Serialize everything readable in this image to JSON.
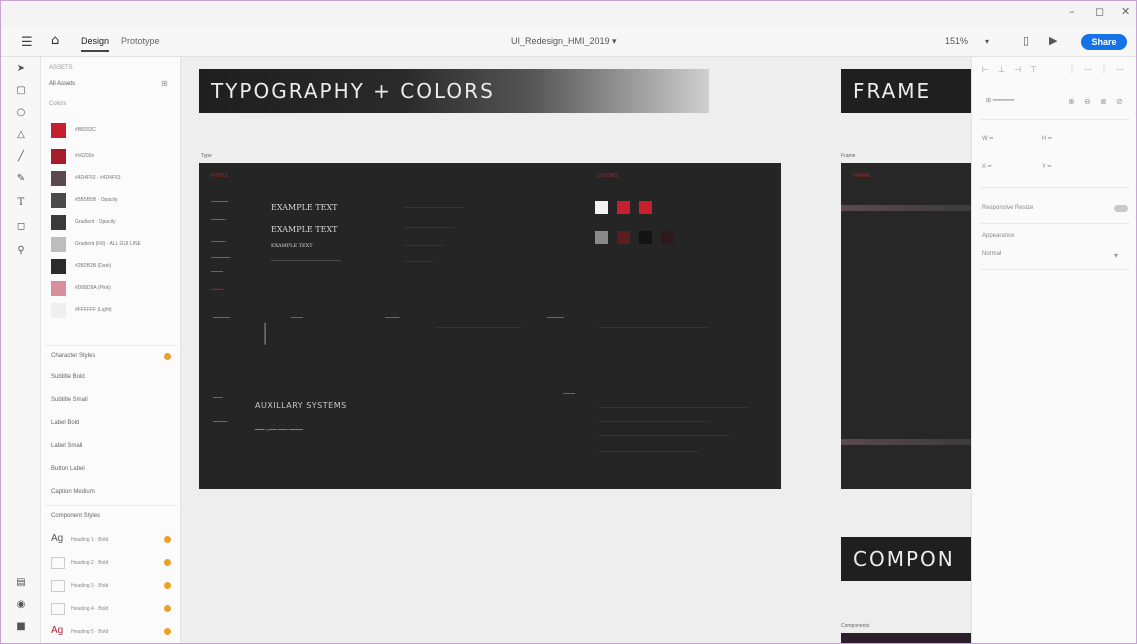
{
  "window": {
    "minimize": "–",
    "maximize": "◻",
    "close": "✕"
  },
  "header": {
    "menu_icon": "hamburger-icon",
    "home_icon": "home-icon",
    "tabs": [
      {
        "label": "Design"
      },
      {
        "label": "Prototype"
      }
    ],
    "document_title": "UI_Redesign_HMI_2019 ▾",
    "zoom": "151%",
    "share_label": "Share"
  },
  "assets": {
    "section_label": "ASSETS",
    "library": "All Assets",
    "colors_label": "Colors",
    "colors": [
      {
        "label": "#B8202C",
        "hex": "#c6202e"
      },
      {
        "label": "#c6202e",
        "hex": "#a51d2a"
      },
      {
        "label": "#4D4F53 · #4D4F53",
        "hex": "#5a4a50"
      },
      {
        "label": "#5B5B5B · Opacity",
        "hex": "#4a4a4a"
      },
      {
        "label": "Gradient · Opacity",
        "hex": "#3a3a3a"
      },
      {
        "label": "Gradient (Fill) · ALL GUI LINE",
        "hex": "#bdbdbd"
      },
      {
        "label": "#2B2B2B (Dark)",
        "hex": "#2b2b2b"
      },
      {
        "label": "#D68D9A (Pink)",
        "hex": "#d88f9c"
      },
      {
        "label": "#FFFFFF (Light)",
        "hex": "#efefef"
      }
    ],
    "character_styles_label": "Character Styles",
    "char_items": [
      "Subtitle Bold",
      "Subtitle Small",
      "Label Bold",
      "Label Small",
      "Button Label",
      "Caption Medium"
    ],
    "components_label": "Component Styles",
    "components": [
      {
        "glyph": "Ag",
        "label": "Heading 1 · Bold",
        "red": false
      },
      {
        "glyph": "",
        "label": "Heading 2 · Bold",
        "red": false
      },
      {
        "glyph": "",
        "label": "Heading 3 · Bold",
        "red": false
      },
      {
        "glyph": "",
        "label": "Heading 4 · Bold",
        "red": false
      },
      {
        "glyph": "Ag",
        "label": "Heading 5 · Bold",
        "red": true
      }
    ]
  },
  "canvas": {
    "banner_typography": "TYPOGRAPHY + COLORS",
    "banner_frame": "FRAME",
    "banner_components": "COMPON",
    "artboard_typo_label": "Type",
    "artboard_frame_label": "Frame",
    "artboard_comp_label": "Components",
    "fonts_label": "FONTS",
    "colors_label": "COLORS",
    "example_1": "EXAMPLE TEXT",
    "example_2": "EXAMPLE TEXT",
    "example_3": "EXAMPLE TEXT",
    "auxillary": "AUXILLARY SYSTEMS",
    "frame_title": "FRAME"
  },
  "properties": {
    "responsive_resize": "Responsive Resize",
    "appearance": "Appearance",
    "blend": "Normal"
  },
  "colors": {
    "accent": "#1473e6",
    "brand_red": "#c6202e",
    "canvas_dark": "#252525"
  }
}
